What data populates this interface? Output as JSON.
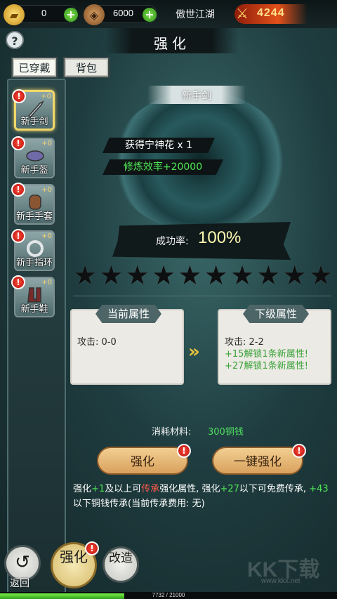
{
  "topbar": {
    "gold": "0",
    "coins": "6000",
    "server_name": "傲世江湖",
    "power": "4244"
  },
  "header": {
    "help": "?",
    "title": "强化"
  },
  "tabs": [
    {
      "label": "已穿戴",
      "active": true
    },
    {
      "label": "背包",
      "active": false
    }
  ],
  "equipment": [
    {
      "name": "新手剑",
      "level": "+0",
      "selected": true
    },
    {
      "name": "新手盔",
      "level": "+0",
      "selected": false
    },
    {
      "name": "新手手套",
      "level": "+0",
      "selected": false
    },
    {
      "name": "新手指环",
      "level": "+0",
      "selected": false
    },
    {
      "name": "新手鞋",
      "level": "+0",
      "selected": false
    }
  ],
  "item": {
    "name": "新手剑",
    "reward_1": "获得宁神花 x 1",
    "reward_2": "修炼效率+20000",
    "success_label": "成功率:",
    "success_rate": "100%",
    "stars_total": 10,
    "stars_filled": 0
  },
  "current_attr": {
    "title": "当前属性",
    "line1": "攻击: 0-0"
  },
  "next_attr": {
    "title": "下级属性",
    "line1": "攻击: 2-2",
    "line2": "+15解锁1条新属性!",
    "line3": "+27解锁1条新属性!"
  },
  "cost": {
    "label": "消耗材料:",
    "value": "300铜钱"
  },
  "buttons": {
    "enhance": "强化",
    "one_click": "一键强化"
  },
  "description": {
    "p1": "强化",
    "p2": "+1",
    "p3": "及以上可",
    "p4": "传承",
    "p5": "强化属性, 强化",
    "p6": "+27",
    "p7": "以下可免费传承, ",
    "p8": "+43",
    "p9": "以下铜钱传承(当前传承费用: 无)"
  },
  "bottom_nav": {
    "back": "返回",
    "enhance": "强化",
    "reforge": "改造"
  },
  "badge": "!",
  "watermark": {
    "main": "KK下载",
    "sub": "www.kkx.net"
  },
  "xp": {
    "text": "7732 / 21000",
    "current": 7732,
    "max": 21000
  },
  "colors": {
    "accent_green": "#4ee856",
    "highlight_red": "#ff5a4a",
    "gold": "#f0d76a"
  }
}
